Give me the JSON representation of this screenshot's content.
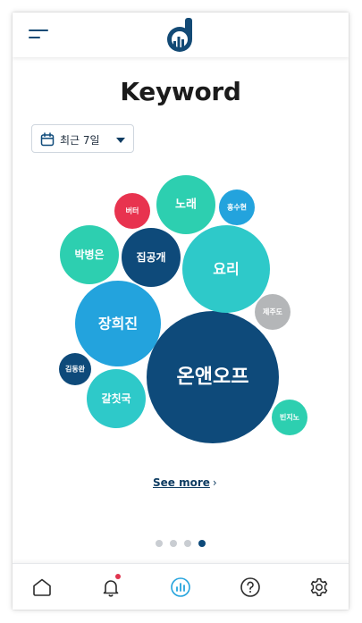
{
  "header": {
    "menu_icon": "hamburger-menu-icon",
    "logo_icon": "app-logo-d-icon",
    "brand_color": "#134a75"
  },
  "page": {
    "title": "Keyword"
  },
  "date_filter": {
    "selected": "최근 7일",
    "icon": "calendar-icon",
    "caret_icon": "caret-down-icon"
  },
  "keywords": [
    {
      "label": "온앤오프",
      "color": "#0e4a7a",
      "rank": 1
    },
    {
      "label": "요리",
      "color": "#2ec9c9",
      "rank": 2
    },
    {
      "label": "장희진",
      "color": "#23a3dd",
      "rank": 3
    },
    {
      "label": "노래",
      "color": "#2dcfb0",
      "rank": 4
    },
    {
      "label": "갈칫국",
      "color": "#2ec9c9",
      "rank": 5
    },
    {
      "label": "박병은",
      "color": "#2dcfb0",
      "rank": 6
    },
    {
      "label": "집공개",
      "color": "#0e4a7a",
      "rank": 7
    },
    {
      "label": "제주도",
      "color": "#b4b6b8",
      "rank": 8
    },
    {
      "label": "빈지노",
      "color": "#2dcfb0",
      "rank": 9
    },
    {
      "label": "홍수현",
      "color": "#23a3dd",
      "rank": 10
    },
    {
      "label": "버터",
      "color": "#e8334f",
      "rank": 11
    },
    {
      "label": "김동완",
      "color": "#0e4a7a",
      "rank": 12
    }
  ],
  "see_more": {
    "label": "See more",
    "chevron": "›"
  },
  "pager": {
    "total": 4,
    "active_index": 3,
    "active_color": "#0e4a7a",
    "inactive_color": "#c9cdd2"
  },
  "bottom_nav": {
    "items": [
      {
        "name": "home",
        "icon": "home-icon",
        "active": false
      },
      {
        "name": "notifications",
        "icon": "bell-icon",
        "active": false,
        "has_badge": true
      },
      {
        "name": "stats",
        "icon": "bar-chart-icon",
        "active": true
      },
      {
        "name": "help",
        "icon": "question-icon",
        "active": false
      },
      {
        "name": "settings",
        "icon": "gear-icon",
        "active": false
      }
    ],
    "active_color": "#23a3dd",
    "inactive_color": "#2b2b2b",
    "badge_color": "#e0354f"
  }
}
